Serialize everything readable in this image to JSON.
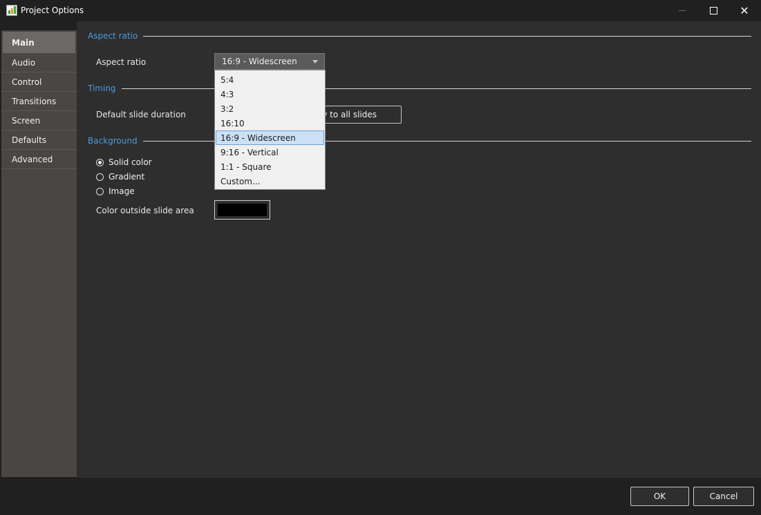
{
  "window": {
    "title": "Project Options",
    "icon": "app-chart-icon"
  },
  "sidebar": {
    "items": [
      {
        "label": "Main",
        "active": true
      },
      {
        "label": "Audio"
      },
      {
        "label": "Control"
      },
      {
        "label": "Transitions"
      },
      {
        "label": "Screen"
      },
      {
        "label": "Defaults"
      },
      {
        "label": "Advanced"
      }
    ]
  },
  "aspect_section": {
    "title": "Aspect ratio",
    "label": "Aspect ratio",
    "selected": "16:9 - Widescreen",
    "options": [
      "5:4",
      "4:3",
      "3:2",
      "16:10",
      "16:9 - Widescreen",
      "9:16 - Vertical",
      "1:1 - Square",
      "Custom..."
    ]
  },
  "timing_section": {
    "title": "Timing",
    "duration_label": "Default slide duration",
    "apply_button": "ply to all slides"
  },
  "background_section": {
    "title": "Background",
    "options": [
      {
        "label": "Solid color",
        "checked": true
      },
      {
        "label": "Gradient",
        "checked": false
      },
      {
        "label": "Image",
        "checked": false
      }
    ],
    "color_label": "Color outside slide area",
    "color_value": "#000000"
  },
  "footer": {
    "ok": "OK",
    "cancel": "Cancel"
  }
}
